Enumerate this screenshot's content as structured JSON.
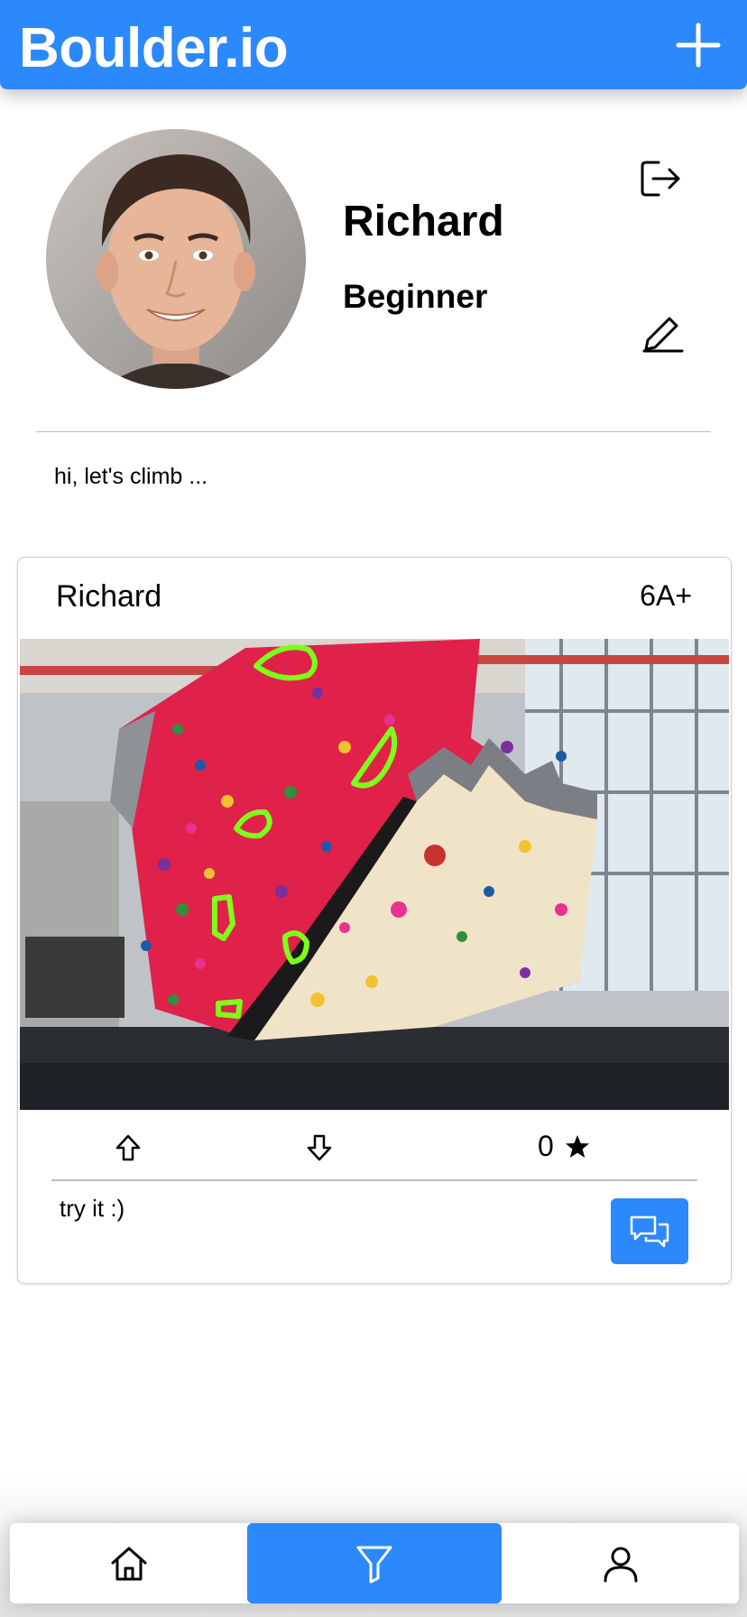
{
  "header": {
    "title": "Boulder.io",
    "add_icon": "plus-icon"
  },
  "profile": {
    "name": "Richard",
    "level": "Beginner",
    "avatar_icon": "profile-photo",
    "logout_icon": "logout-icon",
    "edit_icon": "pencil-icon",
    "bio": "hi, let's climb ..."
  },
  "post": {
    "author": "Richard",
    "grade": "6A+",
    "rating_count": "0",
    "comment": "try it :)",
    "upvote_icon": "arrow-up-icon",
    "downvote_icon": "arrow-down-icon",
    "star_icon": "star-icon",
    "chat_icon": "chat-bubbles-icon"
  },
  "bottom_nav": {
    "items": [
      {
        "id": "home",
        "icon": "home-icon",
        "active": false
      },
      {
        "id": "filter",
        "icon": "filter-icon",
        "active": true
      },
      {
        "id": "profile",
        "icon": "user-icon",
        "active": false
      }
    ]
  },
  "colors": {
    "accent": "#2c89fb",
    "hold_highlight": "#7dff1a",
    "wall_red": "#e0214a",
    "wall_cream": "#efe3c8"
  }
}
